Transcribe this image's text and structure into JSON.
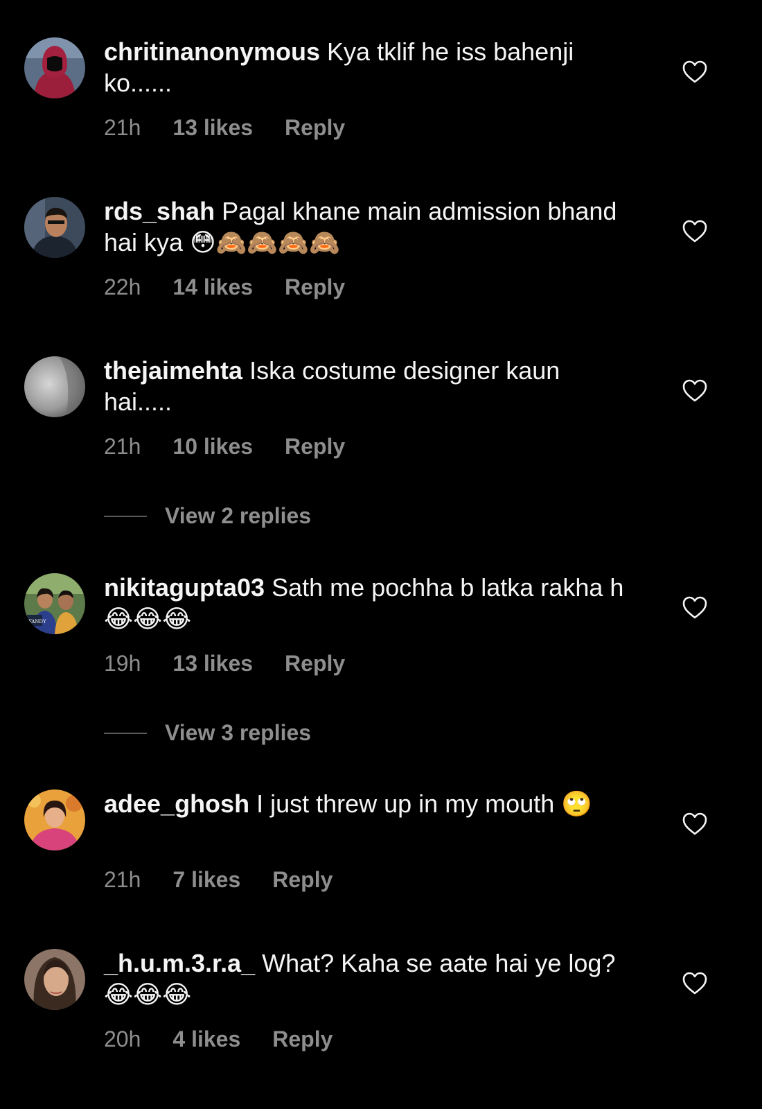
{
  "comments": [
    {
      "username": "chritinanonymous",
      "text": "Kya tklif he iss bahenji ko......",
      "time": "21h",
      "likes": "13 likes",
      "reply": "Reply",
      "avatar": "hooded-figure-avatar"
    },
    {
      "username": "rds_shah",
      "text": "Pagal khane main  admission bhand hai kya 😳🙈🙈🙈🙈",
      "time": "22h",
      "likes": "14 likes",
      "reply": "Reply",
      "avatar": "man-selfie-avatar"
    },
    {
      "username": "thejaimehta",
      "text": "Iska costume designer kaun hai.....",
      "time": "21h",
      "likes": "10 likes",
      "reply": "Reply",
      "avatar": "gray-blur-avatar",
      "view_replies": "View 2 replies"
    },
    {
      "username": "nikitagupta03",
      "text": "Sath me pochha b latka rakha h😂😂😂",
      "time": "19h",
      "likes": "13 likes",
      "reply": "Reply",
      "avatar": "couple-photo-avatar",
      "view_replies": "View 3 replies"
    },
    {
      "username": "adee_ghosh",
      "text": "I just threw up in my mouth 🙄",
      "time": "21h",
      "likes": "7 likes",
      "reply": "Reply",
      "avatar": "woman-pink-avatar"
    },
    {
      "username": "_h.u.m.3.r.a_",
      "text": "What? Kaha se aate hai ye log?😂😂😂",
      "time": "20h",
      "likes": "4 likes",
      "reply": "Reply",
      "avatar": "woman-portrait-avatar"
    }
  ],
  "colors": {
    "background": "#000000",
    "primary_text": "#f5f5f5",
    "secondary_text": "#8e8e8e"
  },
  "icons": {
    "like": "heart-outline-icon"
  }
}
